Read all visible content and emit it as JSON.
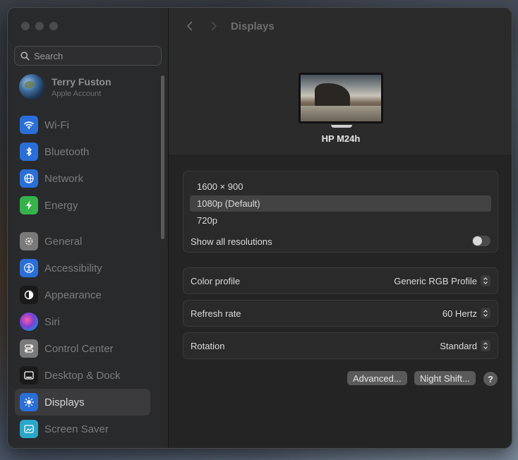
{
  "search": {
    "placeholder": "Search"
  },
  "account": {
    "name": "Terry Fuston",
    "subtitle": "Apple Account"
  },
  "sidebar": {
    "items": [
      {
        "label": "Wi-Fi",
        "icon": "wifi-icon",
        "color": "#2a6fd8"
      },
      {
        "label": "Bluetooth",
        "icon": "bluetooth-icon",
        "color": "#2a6fd8"
      },
      {
        "label": "Network",
        "icon": "globe-icon",
        "color": "#2a6fd8"
      },
      {
        "label": "Energy",
        "icon": "bolt-icon",
        "color": "#35b34a"
      },
      {
        "label": "General",
        "icon": "gear-icon",
        "color": "#7a7a7a"
      },
      {
        "label": "Accessibility",
        "icon": "accessibility-icon",
        "color": "#2a6fd8"
      },
      {
        "label": "Appearance",
        "icon": "appearance-icon",
        "color": "#1a1a1a"
      },
      {
        "label": "Siri",
        "icon": "siri-icon",
        "color": "#6a3fb8"
      },
      {
        "label": "Control Center",
        "icon": "control-center-icon",
        "color": "#7a7a7a"
      },
      {
        "label": "Desktop & Dock",
        "icon": "dock-icon",
        "color": "#1a1a1a"
      },
      {
        "label": "Displays",
        "icon": "sun-icon",
        "color": "#2a6fd8"
      },
      {
        "label": "Screen Saver",
        "icon": "screensaver-icon",
        "color": "#2aa7c8"
      }
    ],
    "active": "Displays"
  },
  "header": {
    "title": "Displays",
    "display_name": "HP M24h"
  },
  "resolutions": {
    "options": [
      "1600 × 900",
      "1080p (Default)",
      "720p"
    ],
    "selected": "1080p (Default)",
    "show_all_label": "Show all resolutions",
    "show_all_on": false
  },
  "settings": {
    "color_profile": {
      "label": "Color profile",
      "value": "Generic RGB Profile"
    },
    "refresh_rate": {
      "label": "Refresh rate",
      "value": "60 Hertz"
    },
    "rotation": {
      "label": "Rotation",
      "value": "Standard"
    }
  },
  "buttons": {
    "advanced": "Advanced...",
    "night_shift": "Night Shift...",
    "help": "?"
  }
}
